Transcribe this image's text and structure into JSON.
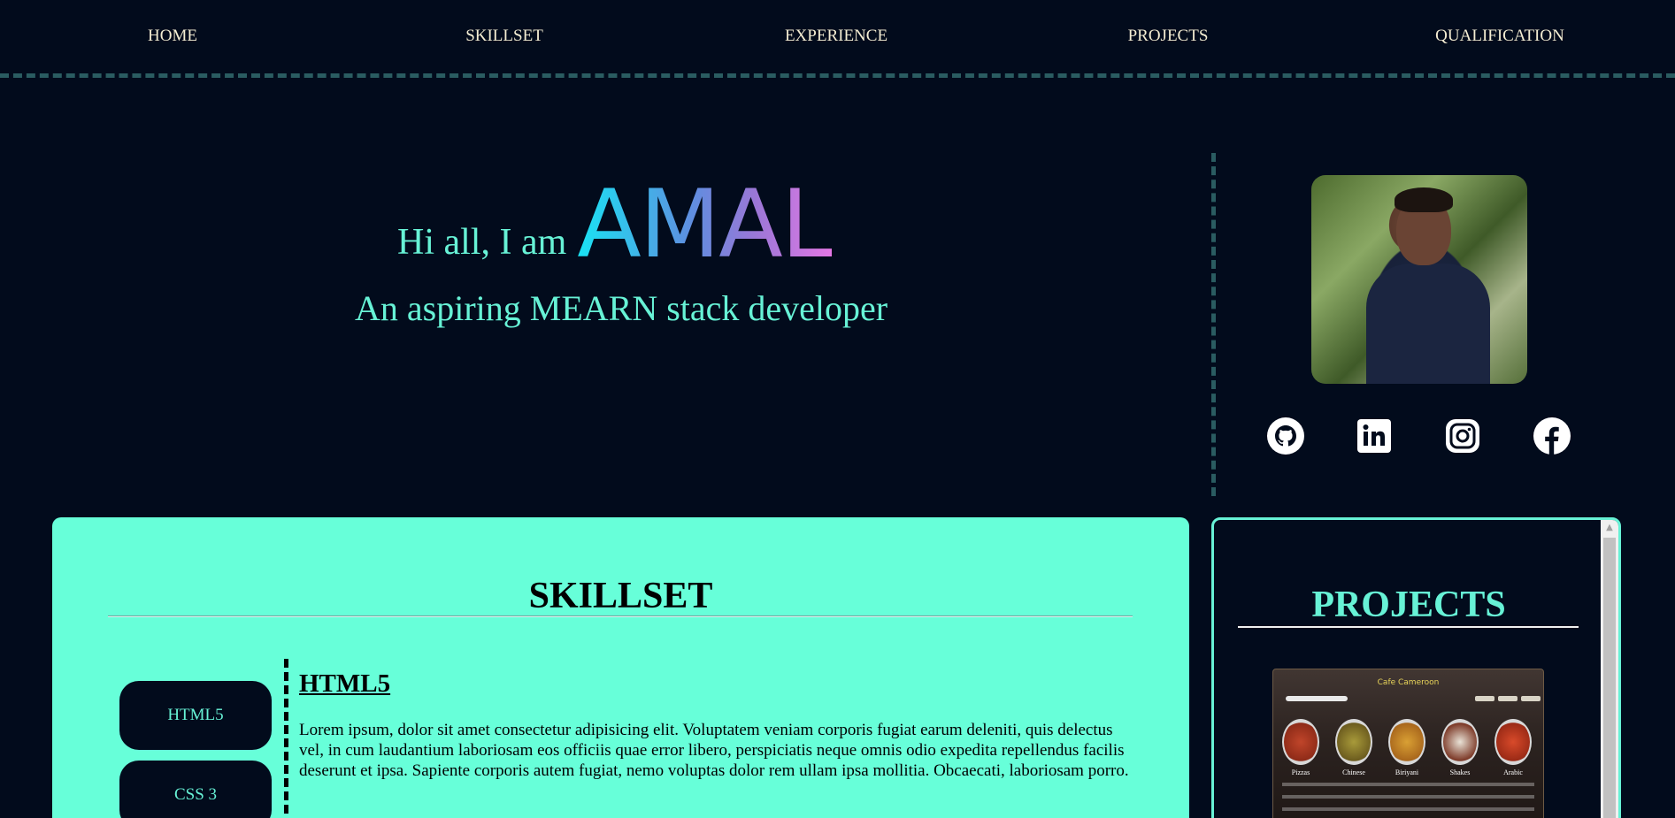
{
  "nav": {
    "items": [
      {
        "label": "HOME"
      },
      {
        "label": "SKILLSET"
      },
      {
        "label": "EXPERIENCE"
      },
      {
        "label": "PROJECTS"
      },
      {
        "label": "QUALIFICATION"
      }
    ]
  },
  "hero": {
    "greeting": "Hi all, I am",
    "name": "AMAL",
    "subtitle": "An aspiring MEARN stack developer",
    "name_gradient": [
      "#19e3f3",
      "#5f8ee0",
      "#9b77d6",
      "#e478e6"
    ]
  },
  "social": {
    "icons": [
      "github-icon",
      "linkedin-icon",
      "instagram-icon",
      "facebook-icon"
    ]
  },
  "skillset": {
    "title": "SKILLSET",
    "buttons": [
      {
        "label": "HTML5"
      },
      {
        "label": "CSS 3"
      }
    ],
    "selected": {
      "heading": "HTML5",
      "description": "Lorem ipsum, dolor sit amet consectetur adipisicing elit. Voluptatem veniam corporis fugiat earum deleniti, quis delectus vel, in cum laudantium laboriosam eos officiis quae error libero, perspiciatis neque omnis odio expedita repellendus facilis deserunt et ipsa. Sapiente corporis autem fugiat, nemo voluptas dolor rem ullam ipsa mollitia. Obcaecati, laboriosam porro."
    }
  },
  "projects": {
    "title": "PROJECTS",
    "preview": {
      "site_title": "Cafe Cameroon",
      "dishes": [
        "Pizzas",
        "Chinese",
        "Biriyani",
        "Shakes",
        "Arabic"
      ]
    }
  },
  "colors": {
    "background": "#020b1c",
    "accent": "#67f2d6",
    "panel": "#67ffd9",
    "nav_text": "#f3ecd2",
    "divider": "#2a5c61"
  }
}
